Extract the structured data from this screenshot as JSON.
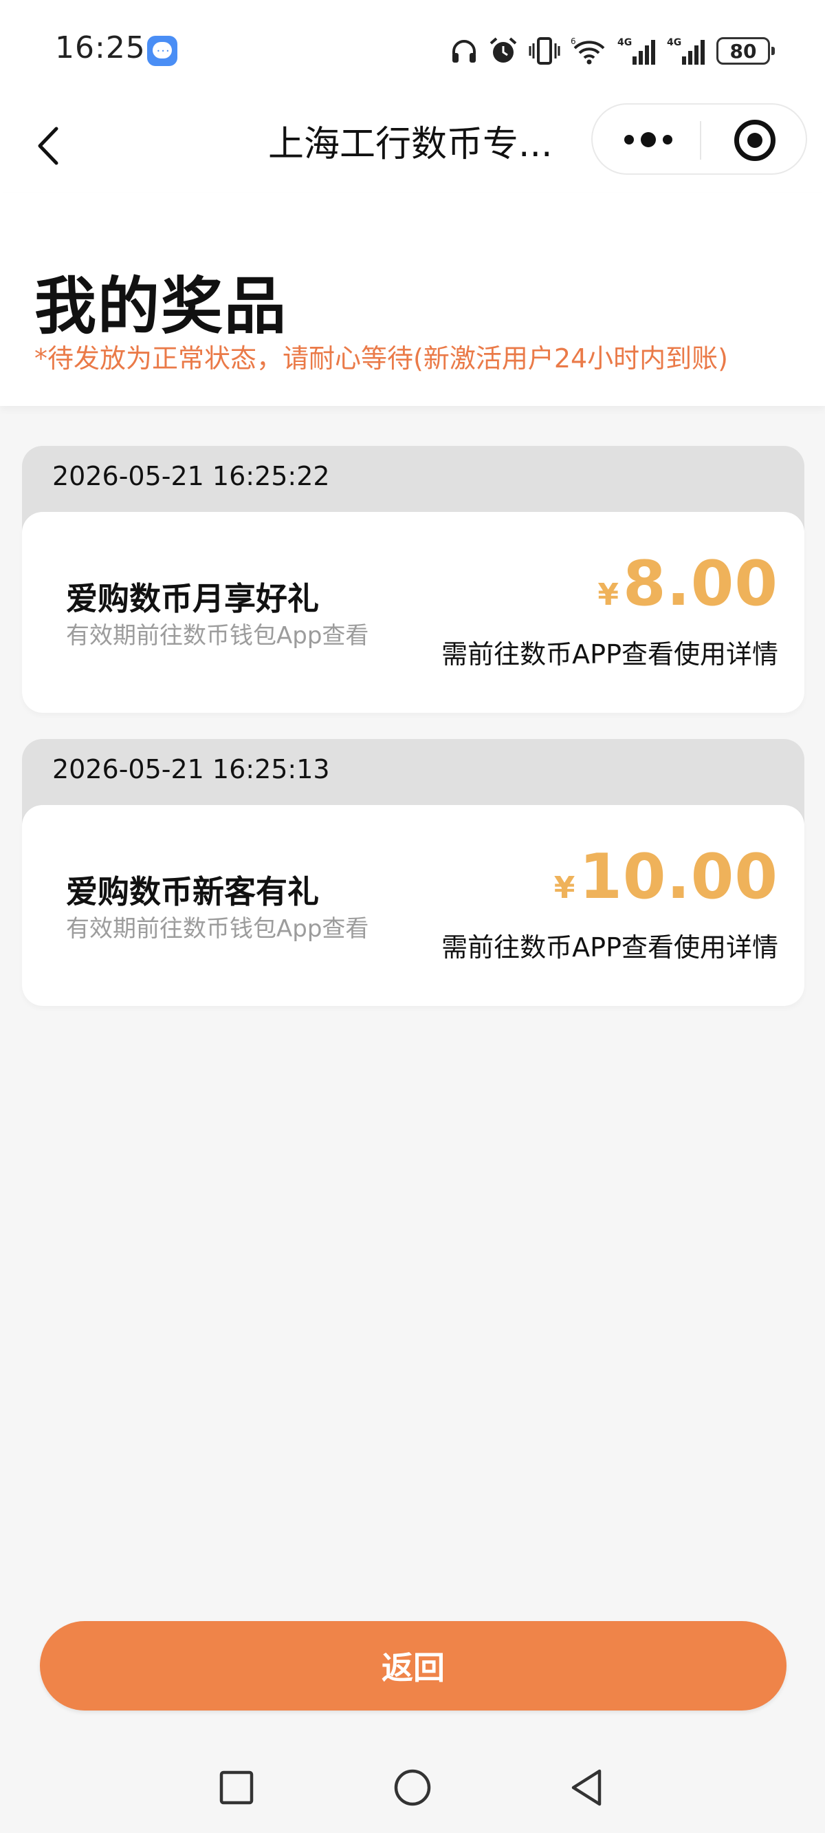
{
  "status_bar": {
    "time": "16:25",
    "battery": "80",
    "icons": [
      "message-app-icon",
      "headphones-icon",
      "alarm-icon",
      "vibrate-icon",
      "wifi-icon",
      "signal-4g-icon",
      "signal-4g-icon",
      "battery-icon"
    ]
  },
  "navbar": {
    "title": "上海工行数币专...",
    "back_icon": "chevron-left-icon",
    "more_icon": "more-dots-icon",
    "close_icon": "target-circle-icon"
  },
  "page": {
    "title": "我的奖品",
    "note": "*待发放为正常状态，请耐心等待(新激活用户24小时内到账)"
  },
  "prizes": [
    {
      "time": "2026-05-21 16:25:22",
      "name": "爱购数币月享好礼",
      "subtitle": "有效期前往数币钱包App查看",
      "currency": "¥",
      "amount": "8.00",
      "detail": "需前往数币APP查看使用详情"
    },
    {
      "time": "2026-05-21 16:25:13",
      "name": "爱购数币新客有礼",
      "subtitle": "有效期前往数币钱包App查看",
      "currency": "¥",
      "amount": "10.00",
      "detail": "需前往数币APP查看使用详情"
    }
  ],
  "return_button": {
    "label": "返回"
  },
  "system_nav": {
    "recents_icon": "square-icon",
    "home_icon": "circle-icon",
    "back_icon": "triangle-back-icon"
  },
  "colors": {
    "accent": "#ef8449",
    "note": "#ea7a48",
    "amount": "#efb25a"
  }
}
